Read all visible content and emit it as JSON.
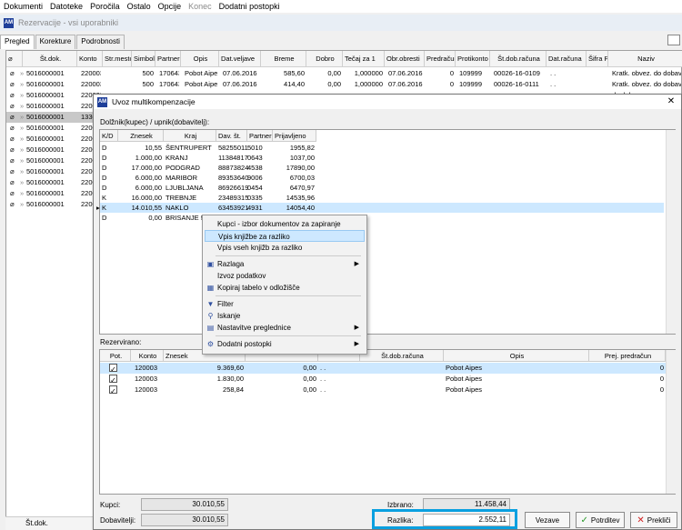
{
  "menubar": {
    "items": [
      "Dokumenti",
      "Datoteke",
      "Poročila",
      "Ostalo",
      "Opcije",
      "Konec",
      "Dodatni postopki"
    ]
  },
  "main_window": {
    "title": "Rezervacije - vsi uporabniki",
    "app_icon": "AM",
    "tabs": [
      "Pregled",
      "Korekture",
      "Podrobnosti"
    ]
  },
  "bg_table": {
    "columns": [
      "",
      "Št.dok.",
      "Konto",
      "Str.mesto",
      "Simbol",
      "Partner",
      "Opis",
      "Dat.veljave",
      "Breme",
      "Dobro",
      "Tečaj za 1",
      "Obr.obresti",
      "Predračun",
      "Protikonto",
      "Št.dob.računa",
      "Dat.računa",
      "Šifra Pl",
      "Naziv"
    ],
    "rows": [
      {
        "dok": "5016000001",
        "konto": "220003",
        "simbol": "500",
        "partner": "170643",
        "opis": "Pobot Aipes",
        "dat": "07.06.2016",
        "breme": "585,60",
        "dobro": "0,00",
        "tecaj": "1,000000",
        "obr": "07.06.2016",
        "pred": "0",
        "proti": "109999",
        "dobrac": "00026-16-0109",
        "datrac": ". .",
        "naziv": "Kratk. obvez. do dobav"
      },
      {
        "dok": "5016000001",
        "konto": "220003",
        "simbol": "500",
        "partner": "170643",
        "opis": "Pobot Aipes",
        "dat": "07.06.2016",
        "breme": "414,40",
        "dobro": "0,00",
        "tecaj": "1,000000",
        "obr": "07.06.2016",
        "pred": "0",
        "proti": "109999",
        "dobrac": "00026-16-0111",
        "datrac": ". .",
        "naziv": "Kratk. obvez. do dobav"
      },
      {
        "dok": "5016000001",
        "konto": "220003",
        "simbol": "",
        "partner": "",
        "opis": "",
        "dat": "",
        "breme": "",
        "dobro": "",
        "tecaj": "",
        "obr": "",
        "pred": "",
        "proti": "",
        "dobrac": "",
        "datrac": "",
        "naziv": "do dobav"
      },
      {
        "dok": "5016000001",
        "konto": "220003",
        "simbol": "",
        "partner": "",
        "opis": "",
        "dat": "",
        "breme": "",
        "dobro": "",
        "tecaj": "",
        "obr": "",
        "pred": "",
        "proti": "",
        "dobrac": "",
        "datrac": "",
        "naziv": "do dobav"
      },
      {
        "dok": "5016000001",
        "konto": "133000",
        "simbol": "",
        "partner": "",
        "opis": "",
        "dat": "",
        "breme": "",
        "dobro": "",
        "tecaj": "",
        "obr": "",
        "pred": "",
        "proti": "",
        "dobrac": "",
        "datrac": "",
        "naziv": "v državi"
      },
      {
        "dok": "5016000001",
        "konto": "220003",
        "simbol": "",
        "partner": "",
        "opis": "",
        "dat": "",
        "breme": "",
        "dobro": "",
        "tecaj": "",
        "obr": "",
        "pred": "",
        "proti": "",
        "dobrac": "",
        "datrac": "",
        "naziv": "do dobav"
      },
      {
        "dok": "5016000001",
        "konto": "220003",
        "simbol": "",
        "partner": "",
        "opis": "",
        "dat": "",
        "breme": "",
        "dobro": "",
        "tecaj": "",
        "obr": "",
        "pred": "",
        "proti": "",
        "dobrac": "",
        "datrac": "",
        "naziv": "do dobav"
      },
      {
        "dok": "5016000001",
        "konto": "220003",
        "simbol": "",
        "partner": "",
        "opis": "",
        "dat": "",
        "breme": "",
        "dobro": "",
        "tecaj": "",
        "obr": "",
        "pred": "",
        "proti": "",
        "dobrac": "",
        "datrac": "",
        "naziv": "do dobav"
      },
      {
        "dok": "5016000001",
        "konto": "220003",
        "simbol": "",
        "partner": "",
        "opis": "",
        "dat": "",
        "breme": "",
        "dobro": "",
        "tecaj": "",
        "obr": "",
        "pred": "",
        "proti": "",
        "dobrac": "",
        "datrac": "",
        "naziv": "do dobav"
      },
      {
        "dok": "5016000001",
        "konto": "220003",
        "simbol": "",
        "partner": "",
        "opis": "",
        "dat": "",
        "breme": "",
        "dobro": "",
        "tecaj": "",
        "obr": "",
        "pred": "",
        "proti": "",
        "dobrac": "",
        "datrac": "",
        "naziv": "do dobav"
      },
      {
        "dok": "5016000001",
        "konto": "220003",
        "simbol": "",
        "partner": "",
        "opis": "",
        "dat": "",
        "breme": "",
        "dobro": "",
        "tecaj": "",
        "obr": "",
        "pred": "",
        "proti": "",
        "dobrac": "",
        "datrac": "",
        "naziv": "do dobav"
      },
      {
        "dok": "5016000001",
        "konto": "220003",
        "simbol": "",
        "partner": "",
        "opis": "",
        "dat": "",
        "breme": "",
        "dobro": "",
        "tecaj": "",
        "obr": "",
        "pred": "",
        "proti": "",
        "dobrac": "",
        "datrac": "",
        "naziv": "do dobav"
      },
      {
        "dok": "5016000001",
        "konto": "220003",
        "simbol": "",
        "partner": "",
        "opis": "",
        "dat": "",
        "breme": "",
        "dobro": "",
        "tecaj": "",
        "obr": "",
        "pred": "",
        "proti": "",
        "dobrac": "",
        "datrac": "",
        "naziv": "do dobav"
      }
    ],
    "selected_row": 4,
    "footer_label": "Št.dok."
  },
  "dialog": {
    "title": "Uvoz multikompenzacije",
    "section_label": "Dolžnik(kupec) / upnik(dobavitelj):",
    "grid1": {
      "columns": [
        "K/D",
        "Znesek",
        "Kraj",
        "Dav. št.",
        "Partner",
        "Prijavljeno"
      ],
      "rows": [
        {
          "kd": "D",
          "znesek": "10,55",
          "kraj": "ŠENTRUPERT",
          "davst": "58255011",
          "partner": "5010",
          "prijav": "1955,82"
        },
        {
          "kd": "D",
          "znesek": "1.000,00",
          "kraj": "KRANJ",
          "davst": "11384817",
          "partner": "0643",
          "prijav": "1037,00"
        },
        {
          "kd": "D",
          "znesek": "17.000,00",
          "kraj": "PODGRAD",
          "davst": "88873824",
          "partner": "4538",
          "prijav": "17890,00"
        },
        {
          "kd": "D",
          "znesek": "6.000,00",
          "kraj": "MARIBOR",
          "davst": "89353640",
          "partner": "9006",
          "prijav": "6700,03"
        },
        {
          "kd": "D",
          "znesek": "6.000,00",
          "kraj": "LJUBLJANA",
          "davst": "86926619",
          "partner": "0454",
          "prijav": "6470,97"
        },
        {
          "kd": "K",
          "znesek": "16.000,00",
          "kraj": "TREBNJE",
          "davst": "23489315",
          "partner": "0335",
          "prijav": "14535,96"
        },
        {
          "kd": "K",
          "znesek": "14.010,55",
          "kraj": "NAKLO",
          "davst": "63453921",
          "partner": "4931",
          "prijav": "14054,40"
        },
        {
          "kd": "D",
          "znesek": "0,00",
          "kraj": "BRISANJE !",
          "davst": "",
          "partner": "",
          "prijav": ""
        }
      ],
      "selected_row": 6
    },
    "reserved_label": "Rezervirano:",
    "grid2": {
      "columns": [
        "Pot.",
        "Konto",
        "Znesek",
        "",
        "",
        "Št.dob.računa",
        "Opis",
        "Prej. predračun"
      ],
      "rows": [
        {
          "checked": "✓",
          "konto": "120003",
          "znesek": "9.369,60",
          "c4": "0,00",
          "c5": ". .",
          "dobrac": "",
          "opis": "Pobot Aipes",
          "pred": "0"
        },
        {
          "checked": "✓",
          "konto": "120003",
          "znesek": "1.830,00",
          "c4": "0,00",
          "c5": ". .",
          "dobrac": "",
          "opis": "Pobot Aipes",
          "pred": "0"
        },
        {
          "checked": "✓",
          "konto": "120003",
          "znesek": "258,84",
          "c4": "0,00",
          "c5": ". .",
          "dobrac": "",
          "opis": "Pobot Aipes",
          "pred": "0"
        }
      ]
    },
    "footer": {
      "kupci_label": "Kupci:",
      "kupci_value": "30.010,55",
      "dobavitelji_label": "Dobavitelji:",
      "dobavitelji_value": "30.010,55",
      "izbrano_label": "Izbrano:",
      "izbrano_value": "11.458,44",
      "razlika_label": "Razlika:",
      "razlika_value": "2.552,11",
      "vezave_label": "Vezave",
      "potrditev_label": "Potrditev",
      "preklici_label": "Prekliči"
    }
  },
  "context_menu": {
    "items": [
      {
        "label": "Kupci - izbor dokumentov za zapiranje",
        "icon": "",
        "arrow": ""
      },
      {
        "label": "Vpis knjižbe za razliko",
        "icon": "",
        "arrow": ""
      },
      {
        "label": "Vpis vseh knjižb za razliko",
        "icon": "",
        "arrow": ""
      },
      {
        "label": "Razlaga",
        "icon": "info",
        "arrow": "▶"
      },
      {
        "label": "Izvoz podatkov",
        "icon": "",
        "arrow": ""
      },
      {
        "label": "Kopiraj tabelo v odložišče",
        "icon": "copy",
        "arrow": ""
      },
      {
        "label": "Filter",
        "icon": "filter",
        "arrow": ""
      },
      {
        "label": "Iskanje",
        "icon": "search",
        "arrow": ""
      },
      {
        "label": "Nastavitve preglednice",
        "icon": "grid",
        "arrow": "▶"
      },
      {
        "label": "Dodatni postopki",
        "icon": "gear",
        "arrow": "▶"
      }
    ],
    "highlighted": 1
  },
  "colors": {
    "highlight_box": "#0aa0e0",
    "selection": "#cde8ff",
    "app_icon_bg": "#1f3f99"
  }
}
